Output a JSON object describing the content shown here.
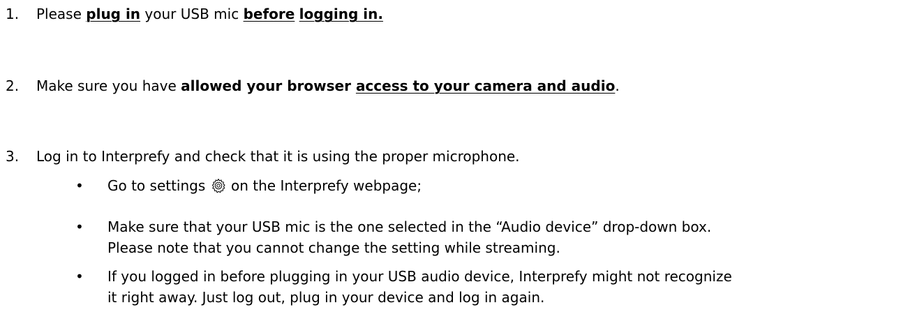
{
  "steps": [
    {
      "number": "1.",
      "parts": {
        "a": "Please ",
        "b": "plug in",
        "c": " your USB mic ",
        "d": "before",
        "e": " ",
        "f": "logging in."
      }
    },
    {
      "number": "2.",
      "parts": {
        "a": "Make sure you have ",
        "b": "allowed your browser ",
        "c": "access to your camera and audio",
        "d": "."
      }
    },
    {
      "number": "3.",
      "text": "Log in to Interprefy and check that it is using the proper microphone."
    }
  ],
  "bullets": [
    {
      "before_icon": "Go to settings ",
      "icon": "settings-gear-icon",
      "after_icon": " on the Interprefy webpage;"
    },
    {
      "line1": "Make sure that your USB mic is the one selected in the “Audio device” drop-down box.",
      "line2": "Please note that you cannot change the setting while streaming."
    },
    {
      "line1": "If you logged in before plugging in your USB audio device, Interprefy might not recognize",
      "line2": "it right away. Just log out, plug in your device and log in again."
    }
  ],
  "bullet_glyph": "•"
}
